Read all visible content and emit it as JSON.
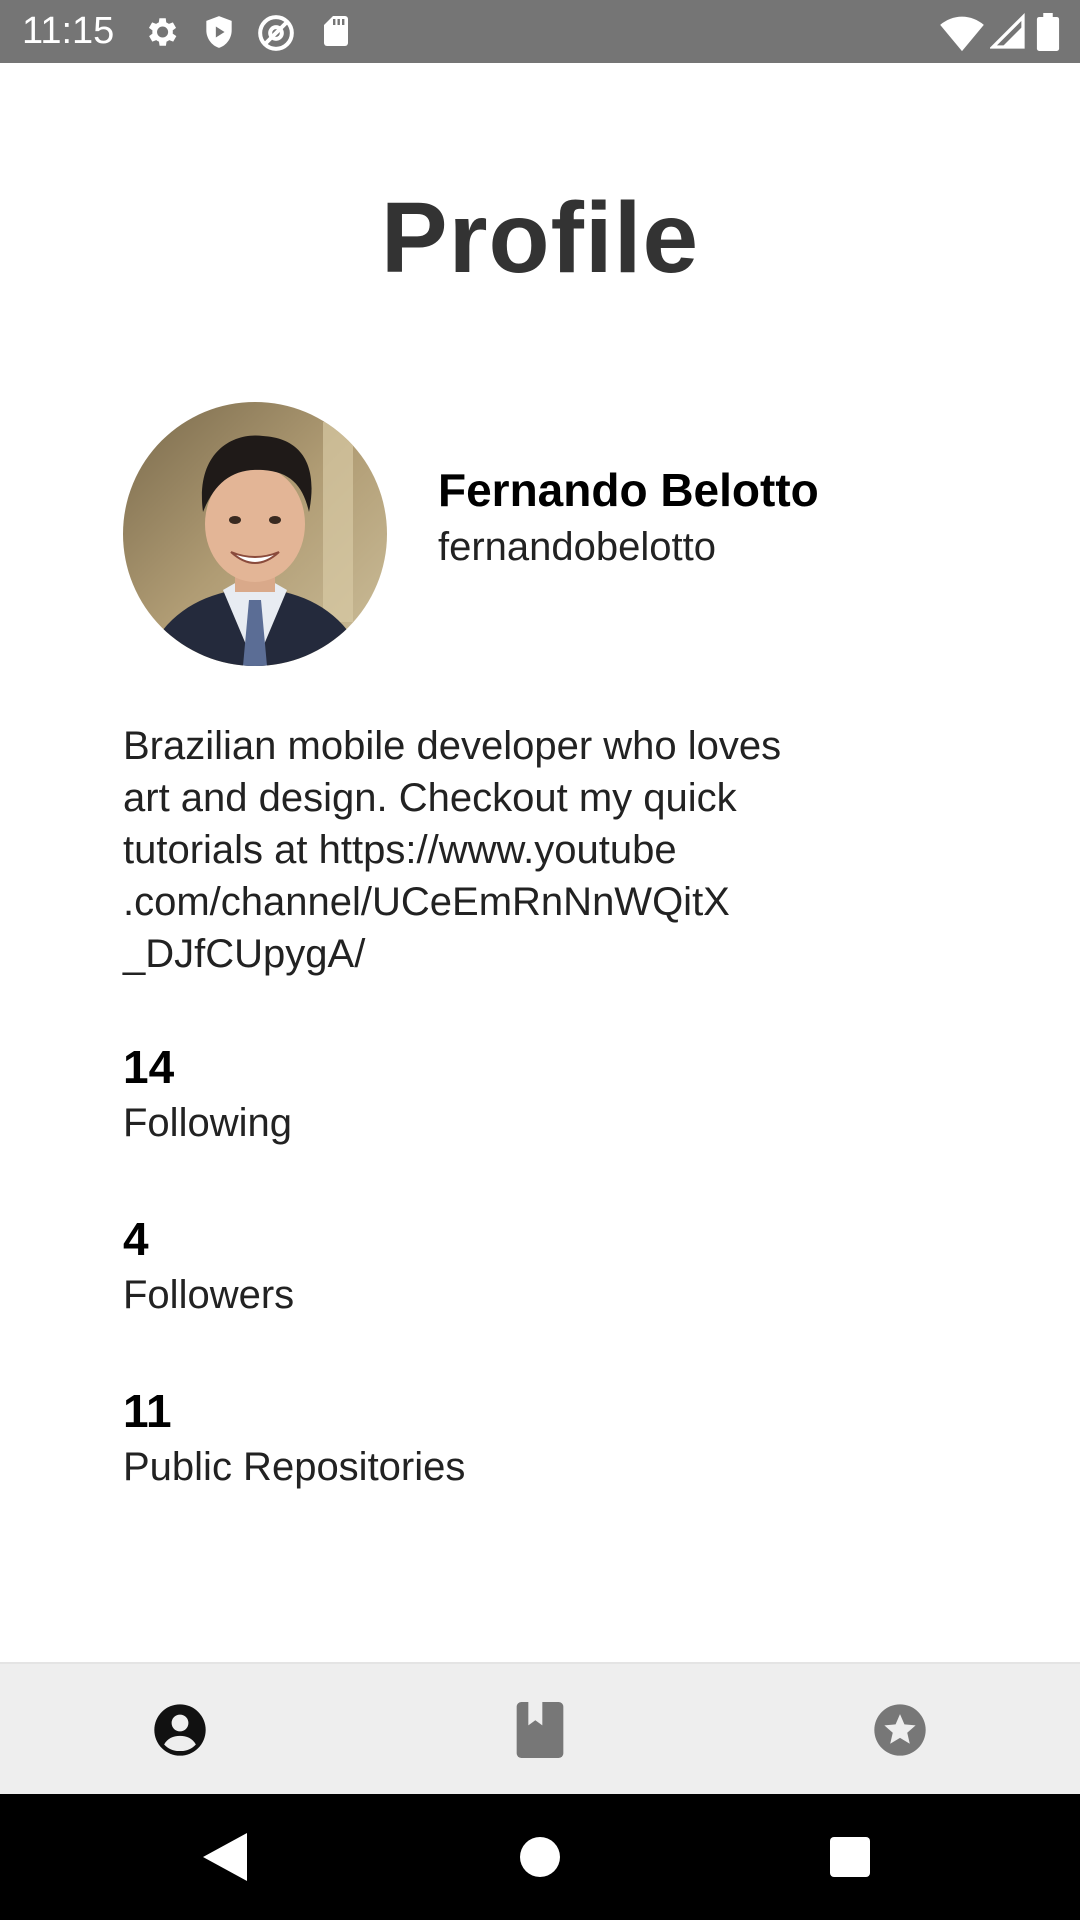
{
  "status_bar": {
    "time": "11:15",
    "left_icons": [
      "gear-icon",
      "shield-icon",
      "at-sign-icon",
      "sd-card-icon"
    ],
    "right_icons": [
      "wifi-icon",
      "signal-icon",
      "battery-icon"
    ]
  },
  "page": {
    "title": "Profile"
  },
  "profile": {
    "name": "Fernando Belotto",
    "username": "fernandobelotto",
    "bio_lines": [
      "Brazilian mobile developer who loves",
      "art and design. Checkout my quick",
      "tutorials at https://www.youtube",
      ".com/channel/UCeEmRnNnWQitX",
      "_DJfCUpygA/"
    ]
  },
  "stats": [
    {
      "value": "14",
      "label": "Following"
    },
    {
      "value": "4",
      "label": "Followers"
    },
    {
      "value": "11",
      "label": "Public Repositories"
    }
  ],
  "bottom_nav": {
    "tabs": [
      {
        "icon": "account-circle-icon",
        "active": true
      },
      {
        "icon": "book-icon",
        "active": false
      },
      {
        "icon": "star-circle-icon",
        "active": false
      }
    ]
  },
  "colors": {
    "status_bar": "#757575",
    "title": "#333333",
    "nav_background": "#eeeeee",
    "nav_active": "#111111",
    "nav_inactive": "#777777"
  }
}
